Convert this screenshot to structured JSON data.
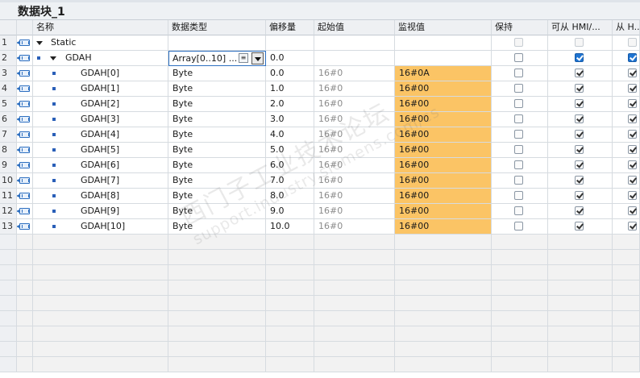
{
  "title": "数据块_1",
  "columns": {
    "name": "名称",
    "type": "数据类型",
    "offset": "偏移量",
    "start": "起始值",
    "monitor": "监视值",
    "retain": "保持",
    "hmi_access": "可从 HMI/...",
    "hmi_visible": "从 H..."
  },
  "rows": [
    {
      "num": "1",
      "name": "Static",
      "type": "",
      "offset": "",
      "start": "",
      "monitor": "",
      "level": 0,
      "expand": true,
      "bullet": false,
      "orange": false,
      "hmi_checked": false,
      "hmi2_checked": false,
      "disabled": true,
      "selected": false
    },
    {
      "num": "2",
      "name": "GDAH",
      "type": "Array[0..10] ...",
      "offset": "0.0",
      "start": "",
      "monitor": "",
      "level": 1,
      "expand": true,
      "bullet": true,
      "orange": false,
      "hmi_checked": true,
      "hmi2_checked": true,
      "disabled": false,
      "selected": true
    },
    {
      "num": "3",
      "name": "GDAH[0]",
      "type": "Byte",
      "offset": "0.0",
      "start": "16#0",
      "monitor": "16#0A",
      "level": 2,
      "expand": false,
      "bullet": true,
      "orange": true,
      "hmi_checked": true,
      "hmi2_checked": true,
      "disabled": false,
      "selected": false
    },
    {
      "num": "4",
      "name": "GDAH[1]",
      "type": "Byte",
      "offset": "1.0",
      "start": "16#0",
      "monitor": "16#00",
      "level": 2,
      "expand": false,
      "bullet": true,
      "orange": true,
      "hmi_checked": true,
      "hmi2_checked": true,
      "disabled": false,
      "selected": false
    },
    {
      "num": "5",
      "name": "GDAH[2]",
      "type": "Byte",
      "offset": "2.0",
      "start": "16#0",
      "monitor": "16#00",
      "level": 2,
      "expand": false,
      "bullet": true,
      "orange": true,
      "hmi_checked": true,
      "hmi2_checked": true,
      "disabled": false,
      "selected": false
    },
    {
      "num": "6",
      "name": "GDAH[3]",
      "type": "Byte",
      "offset": "3.0",
      "start": "16#0",
      "monitor": "16#00",
      "level": 2,
      "expand": false,
      "bullet": true,
      "orange": true,
      "hmi_checked": true,
      "hmi2_checked": true,
      "disabled": false,
      "selected": false
    },
    {
      "num": "7",
      "name": "GDAH[4]",
      "type": "Byte",
      "offset": "4.0",
      "start": "16#0",
      "monitor": "16#00",
      "level": 2,
      "expand": false,
      "bullet": true,
      "orange": true,
      "hmi_checked": true,
      "hmi2_checked": true,
      "disabled": false,
      "selected": false
    },
    {
      "num": "8",
      "name": "GDAH[5]",
      "type": "Byte",
      "offset": "5.0",
      "start": "16#0",
      "monitor": "16#00",
      "level": 2,
      "expand": false,
      "bullet": true,
      "orange": true,
      "hmi_checked": true,
      "hmi2_checked": true,
      "disabled": false,
      "selected": false
    },
    {
      "num": "9",
      "name": "GDAH[6]",
      "type": "Byte",
      "offset": "6.0",
      "start": "16#0",
      "monitor": "16#00",
      "level": 2,
      "expand": false,
      "bullet": true,
      "orange": true,
      "hmi_checked": true,
      "hmi2_checked": true,
      "disabled": false,
      "selected": false
    },
    {
      "num": "10",
      "name": "GDAH[7]",
      "type": "Byte",
      "offset": "7.0",
      "start": "16#0",
      "monitor": "16#00",
      "level": 2,
      "expand": false,
      "bullet": true,
      "orange": true,
      "hmi_checked": true,
      "hmi2_checked": true,
      "disabled": false,
      "selected": false
    },
    {
      "num": "11",
      "name": "GDAH[8]",
      "type": "Byte",
      "offset": "8.0",
      "start": "16#0",
      "monitor": "16#00",
      "level": 2,
      "expand": false,
      "bullet": true,
      "orange": true,
      "hmi_checked": true,
      "hmi2_checked": true,
      "disabled": false,
      "selected": false
    },
    {
      "num": "12",
      "name": "GDAH[9]",
      "type": "Byte",
      "offset": "9.0",
      "start": "16#0",
      "monitor": "16#00",
      "level": 2,
      "expand": false,
      "bullet": true,
      "orange": true,
      "hmi_checked": true,
      "hmi2_checked": true,
      "disabled": false,
      "selected": false
    },
    {
      "num": "13",
      "name": "GDAH[10]",
      "type": "Byte",
      "offset": "10.0",
      "start": "16#0",
      "monitor": "16#00",
      "level": 2,
      "expand": false,
      "bullet": true,
      "orange": true,
      "hmi_checked": true,
      "hmi2_checked": true,
      "disabled": false,
      "selected": false
    }
  ],
  "empty_rows": 9,
  "watermark": {
    "line1": "西门子工业技术论坛",
    "line2": "support.industry.siemens.com/cs"
  },
  "colors": {
    "monitor_highlight": "#fbc465",
    "checkbox_selected": "#1f74d1",
    "icon_blue": "#2d6fc0"
  }
}
